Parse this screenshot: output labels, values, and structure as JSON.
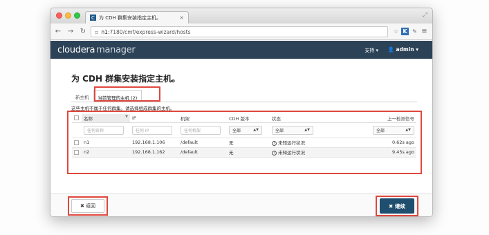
{
  "browser": {
    "tab_title": "为 CDH 群集安装指定主机。",
    "tab_favicon": "C",
    "url_host": "n1",
    "url_rest": ":7180/cmf/express-wizard/hosts",
    "icons": [
      "back-icon",
      "forward-icon",
      "reload-icon",
      "page-icon",
      "star-icon",
      "k-extension-icon",
      "puzzle-icon",
      "menu-icon"
    ]
  },
  "header": {
    "logo_main": "cloudera",
    "logo_sub": "manager",
    "support": "支持 ▾",
    "user": "👤 admin ▾",
    "bg_color": "#2c4257"
  },
  "page": {
    "title": "为 CDH 群集安装指定主机。",
    "tabs": [
      {
        "label": "新主机"
      },
      {
        "label": "当前管理的主机 (2)"
      }
    ],
    "notice": "这些主机不属于任何群集。请选择组成群集的主机。"
  },
  "table": {
    "headers": [
      "名称",
      "IP",
      "机架",
      "CDH 版本",
      "状态",
      "上一检测信号"
    ],
    "filters": {
      "name_placeholder": "任何名称",
      "ip_placeholder": "任何 IP",
      "rack_placeholder": "任何机架",
      "cdh_select": "全部",
      "status_select": "全部",
      "heartbeat_select": "全部"
    },
    "rows": [
      {
        "name": "n1",
        "ip": "192.168.1.106",
        "rack": "/default",
        "cdh": "无",
        "status": "未知运行状况",
        "heartbeat": "0.62s ago"
      },
      {
        "name": "n2",
        "ip": "192.168.1.162",
        "rack": "/default",
        "cdh": "无",
        "status": "未知运行状况",
        "heartbeat": "9.45s ago"
      }
    ]
  },
  "footer": {
    "back_label": "✖ 返回",
    "next_label": "✖ 继续"
  },
  "colors": {
    "highlight": "#e0473d",
    "primary": "#1f4e6e"
  }
}
